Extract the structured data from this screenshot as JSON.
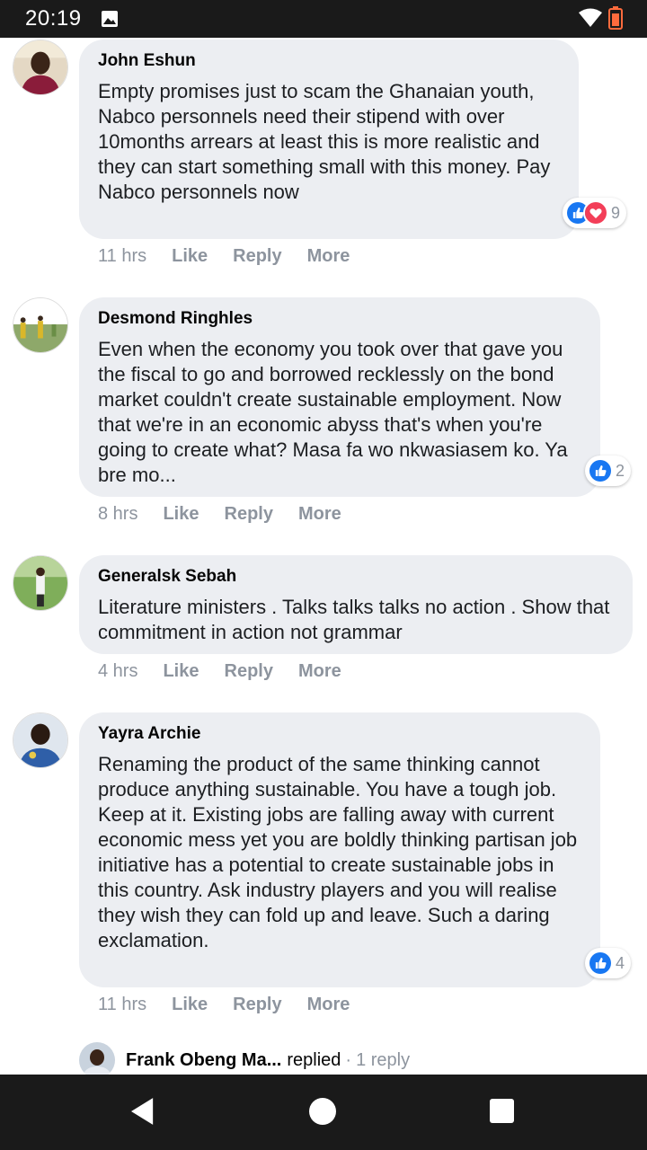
{
  "status_bar": {
    "time": "20:19",
    "icons": [
      "image-icon",
      "wifi-icon",
      "battery-icon"
    ]
  },
  "comments": [
    {
      "author": "John Eshun",
      "text": "Empty promises just to scam the Ghanaian youth, Nabco personnels need their stipend with over 10months arrears at least this is more realistic and they can start something small with this money. Pay Nabco personnels now",
      "time": "11 hrs",
      "reactions": [
        "like",
        "love"
      ],
      "reaction_count": "9"
    },
    {
      "author": "Desmond Ringhles",
      "text": "Even when the economy you took over that gave you the fiscal to go and borrowed recklessly on the bond market couldn't create sustainable employment. Now that we're in an economic abyss that's when you're going to create what? Masa fa wo nkwasiasem ko. Ya bre mo...",
      "time": "8 hrs",
      "reactions": [
        "like"
      ],
      "reaction_count": "2"
    },
    {
      "author": "Generalsk Sebah",
      "text": "Literature ministers . Talks talks talks no action . Show that commitment in action not grammar",
      "time": "4 hrs"
    },
    {
      "author": "Yayra Archie",
      "text": "Renaming the product of the same thinking cannot produce anything sustainable. You have a tough job. Keep at it. Existing jobs are falling away with current economic mess yet you are boldly thinking partisan job initiative has a potential to create sustainable jobs in this country. Ask industry players and you will realise they wish they can fold up and leave. Such a daring exclamation.",
      "time": "11 hrs",
      "reactions": [
        "like"
      ],
      "reaction_count": "4"
    }
  ],
  "actions": {
    "like": "Like",
    "reply": "Reply",
    "more": "More"
  },
  "reply_preview": {
    "name": "Frank Obeng Ma...",
    "verb": "replied",
    "separator": "·",
    "count": "1 reply"
  },
  "colors": {
    "bubble": "#eceef2",
    "like_blue": "#1877f2",
    "love_red": "#f33e58",
    "muted": "#8d949e"
  }
}
